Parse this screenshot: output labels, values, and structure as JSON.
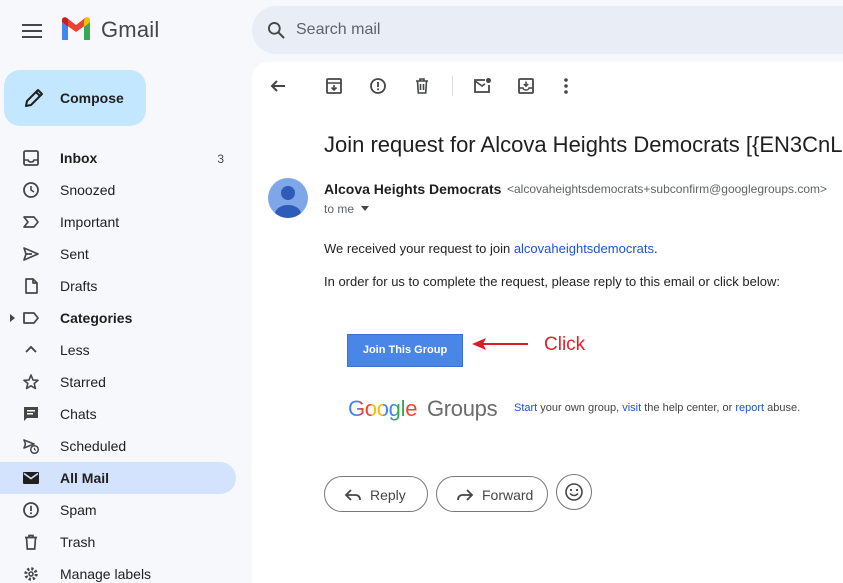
{
  "app": {
    "name": "Gmail",
    "search_placeholder": "Search mail"
  },
  "compose": {
    "label": "Compose"
  },
  "nav": {
    "items": [
      {
        "label": "Inbox",
        "count": "3",
        "icon": "inbox-icon",
        "bold": true
      },
      {
        "label": "Snoozed",
        "icon": "clock-icon"
      },
      {
        "label": "Important",
        "icon": "important-icon"
      },
      {
        "label": "Sent",
        "icon": "send-icon"
      },
      {
        "label": "Drafts",
        "icon": "draft-icon"
      },
      {
        "label": "Categories",
        "icon": "label-icon",
        "bold": true
      },
      {
        "label": "Less",
        "icon": "chevron-up-icon"
      },
      {
        "label": "Starred",
        "icon": "star-icon"
      },
      {
        "label": "Chats",
        "icon": "chat-icon"
      },
      {
        "label": "Scheduled",
        "icon": "scheduled-icon"
      },
      {
        "label": "All Mail",
        "icon": "all-mail-icon",
        "bold": true,
        "active": true
      },
      {
        "label": "Spam",
        "icon": "spam-icon"
      },
      {
        "label": "Trash",
        "icon": "trash-icon"
      },
      {
        "label": "Manage labels",
        "icon": "gear-icon"
      }
    ]
  },
  "message": {
    "subject": "Join request for Alcova Heights Democrats [{EN3CnL",
    "sender_name": "Alcova Heights Democrats",
    "sender_email": "<alcovaheightsdemocrats+subconfirm@googlegroups.com>",
    "recipient": "to me",
    "body_line1_prefix": "We received your request to join ",
    "body_line1_link": "alcovaheightsdemocrats",
    "body_line1_suffix": ".",
    "body_line2": "In order for us to complete the request, please reply to this email or click below:",
    "join_button": "Join This Group",
    "annotation": "Click",
    "gg_logo_google": "Google",
    "gg_logo_groups": "Groups",
    "footer": {
      "start": "Start",
      "t1": " your own group, ",
      "visit": "visit",
      "t2": " the help center, or ",
      "report": "report",
      "t3": " abuse."
    }
  },
  "actions": {
    "reply": "Reply",
    "forward": "Forward"
  },
  "colors": {
    "compose_bg": "#c2e7ff",
    "active_nav": "#d3e3fd",
    "join_button": "#4a86e8",
    "annotation": "#e8202a",
    "link": "#1a55d0"
  }
}
